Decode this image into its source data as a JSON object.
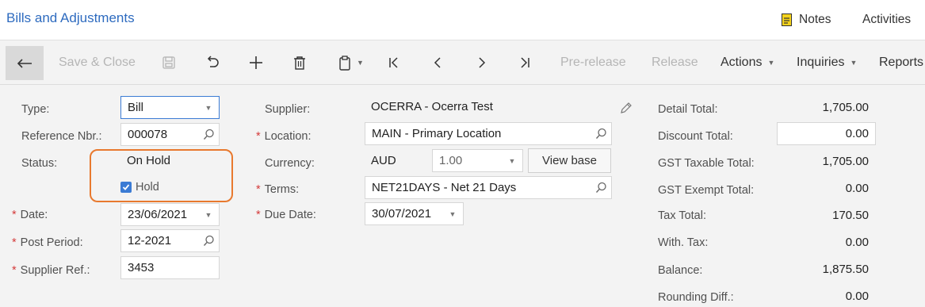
{
  "header": {
    "title": "Bills and Adjustments",
    "notes_label": "Notes",
    "activities_label": "Activities"
  },
  "toolbar": {
    "save_close": "Save & Close",
    "prerelease": "Pre-release",
    "release": "Release",
    "actions": "Actions",
    "inquiries": "Inquiries",
    "reports": "Reports"
  },
  "form": {
    "type_label": "Type:",
    "type_value": "Bill",
    "refnbr_label": "Reference Nbr.:",
    "refnbr_value": "000078",
    "status_label": "Status:",
    "status_value": "On Hold",
    "hold_label": "Hold",
    "hold_checked": true,
    "date_label": "Date:",
    "date_value": "23/06/2021",
    "post_period_label": "Post Period:",
    "post_period_value": "12-2021",
    "supplier_ref_label": "Supplier Ref.:",
    "supplier_ref_value": "3453",
    "supplier_label": "Supplier:",
    "supplier_value": "OCERRA - Ocerra Test",
    "location_label": "Location:",
    "location_value": "MAIN - Primary Location",
    "currency_label": "Currency:",
    "currency_value": "AUD",
    "rate_value": "1.00",
    "view_base_label": "View base",
    "terms_label": "Terms:",
    "terms_value": "NET21DAYS - Net 21 Days",
    "due_date_label": "Due Date:",
    "due_date_value": "30/07/2021"
  },
  "totals": {
    "detail_total_label": "Detail Total:",
    "detail_total_value": "1,705.00",
    "discount_total_label": "Discount Total:",
    "discount_total_value": "0.00",
    "gst_taxable_label": "GST Taxable Total:",
    "gst_taxable_value": "1,705.00",
    "gst_exempt_label": "GST Exempt Total:",
    "gst_exempt_value": "0.00",
    "tax_total_label": "Tax Total:",
    "tax_total_value": "170.50",
    "with_tax_label": "With. Tax:",
    "with_tax_value": "0.00",
    "balance_label": "Balance:",
    "balance_value": "1,875.50",
    "rounding_diff_label": "Rounding Diff.:",
    "rounding_diff_value": "0.00"
  },
  "colors": {
    "accent": "#2e6bbf",
    "highlight": "#e8792e",
    "required": "#d43a3a"
  }
}
